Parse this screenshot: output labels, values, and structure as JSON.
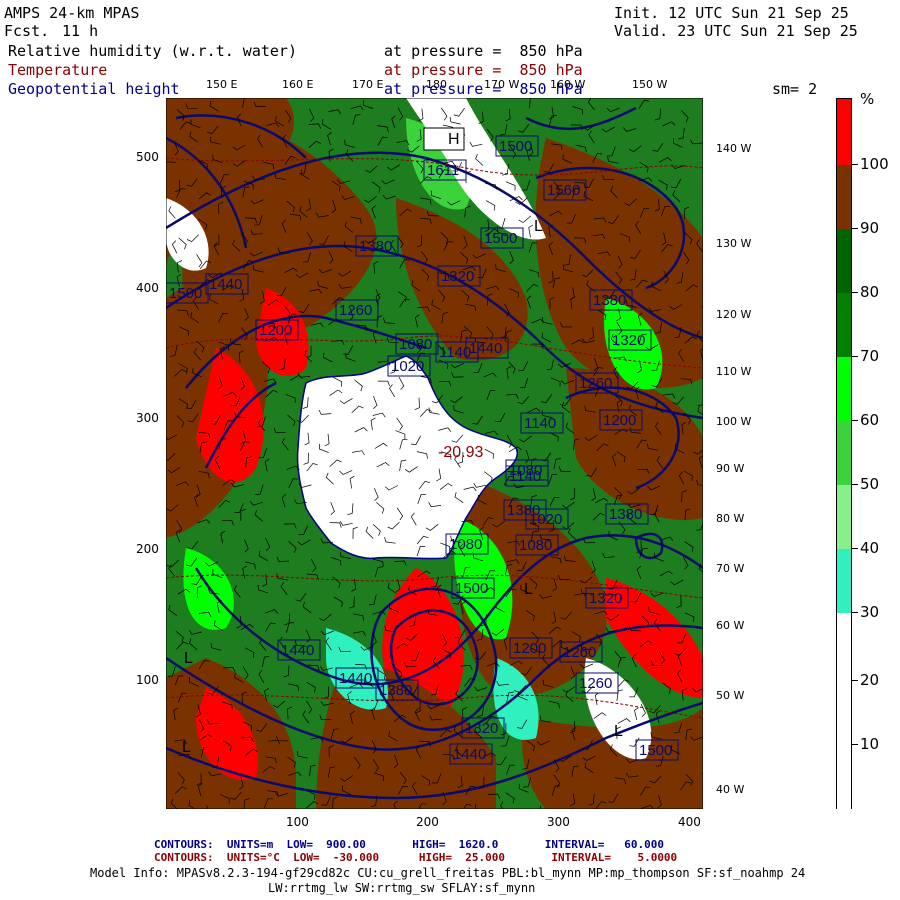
{
  "header": {
    "model": "AMPS 24-km MPAS",
    "fcst_label": "Fcst.",
    "fcst_value": "11 h",
    "init": "Init. 12 UTC Sun 21 Sep 25",
    "valid": "Valid. 23 UTC Sun 21 Sep 25"
  },
  "fields": [
    {
      "name": "Relative humidity (w.r.t. water)",
      "level": "at pressure =  850 hPa",
      "color": "#000000"
    },
    {
      "name": "Temperature",
      "level": "at pressure =  850 hPa",
      "color": "#8b0000"
    },
    {
      "name": "Geopotential height",
      "level": "at pressure =  850 hPa",
      "color": "#00008b"
    }
  ],
  "smoothing": "sm= 2",
  "map": {
    "top_longitudes": [
      "150 E",
      "160 E",
      "170 E",
      "180",
      "170 W",
      "160 W",
      "150 W"
    ],
    "right_longitudes": [
      "140 W",
      "130 W",
      "120 W",
      "110 W",
      "100 W",
      "90 W",
      "80 W",
      "70 W",
      "60 W",
      "50 W",
      "40 W"
    ],
    "y_ticks": [
      "500",
      "400",
      "300",
      "200",
      "100"
    ],
    "x_ticks": [
      "100",
      "200",
      "300",
      "400"
    ],
    "center_temp": "-20.93",
    "height_labels": [
      "1500",
      "1611",
      "1560",
      "1500",
      "1440",
      "1380",
      "1320",
      "1260",
      "1200",
      "1140",
      "1080",
      "1020",
      "1500",
      "1440",
      "1380",
      "1320",
      "1260",
      "1200",
      "1140",
      "1080",
      "1020",
      "1380",
      "1440",
      "1500",
      "1440",
      "1380",
      "1320",
      "1260",
      "1200",
      "1260",
      "1320",
      "1380",
      "1440",
      "1500",
      "1080",
      "1080",
      "1140"
    ],
    "pressure_highs": [
      "H"
    ],
    "pressure_lows": [
      "L",
      "L",
      "L",
      "L",
      "L"
    ]
  },
  "colorbar": {
    "unit": "%",
    "levels": [
      "100",
      "90",
      "80",
      "70",
      "60",
      "50",
      "40",
      "30",
      "20",
      "10"
    ],
    "colors": [
      "#ff0000",
      "#7a3300",
      "#006400",
      "#007f00",
      "#00ff00",
      "#3cd23c",
      "#88f088",
      "#30f0c0",
      "#ffffff",
      "#ffffff"
    ]
  },
  "footer": {
    "line1": "CONTOURS:  UNITS=m  LOW=  900.00       HIGH=  1620.0       INTERVAL=   60.000",
    "line2": "CONTOURS:  UNITS=°C  LOW=  -30.000      HIGH=  25.000       INTERVAL=    5.0000",
    "line3": "Model Info: MPASv8.2.3-194-gf29cd82c CU:cu_grell_freitas PBL:bl_mynn MP:mp_thompson SF:sf_noahmp 24",
    "line4": "LW:rrtmg_lw SW:rrtmg_sw SFLAY:sf_mynn"
  }
}
